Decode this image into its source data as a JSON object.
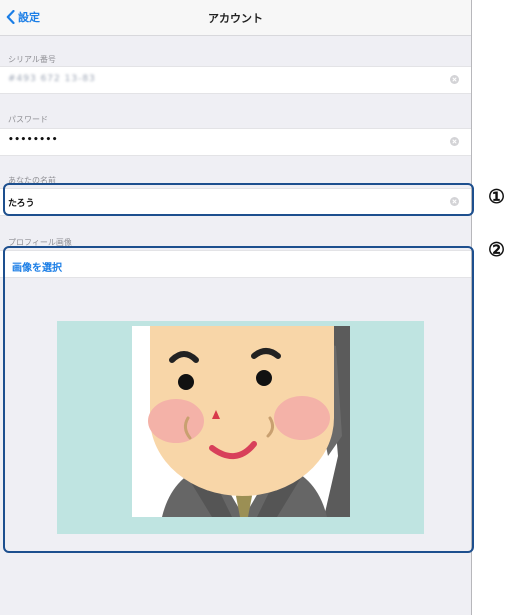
{
  "navbar": {
    "back_label": "設定",
    "title": "アカウント"
  },
  "serial": {
    "label": "シリアル番号",
    "value": "#493 672 13-83"
  },
  "password": {
    "label": "パスワード",
    "value": "••••••••"
  },
  "name": {
    "label": "あなたの名前",
    "value": "たろう"
  },
  "profile_image": {
    "label": "プロフィール画像",
    "select_label": "画像を選択"
  },
  "callouts": {
    "marker_1": "①",
    "marker_2": "②"
  },
  "colors": {
    "accent": "#1b7ee6",
    "callout_border": "#1d4f8e",
    "preview_background": "#bfe4e1"
  }
}
